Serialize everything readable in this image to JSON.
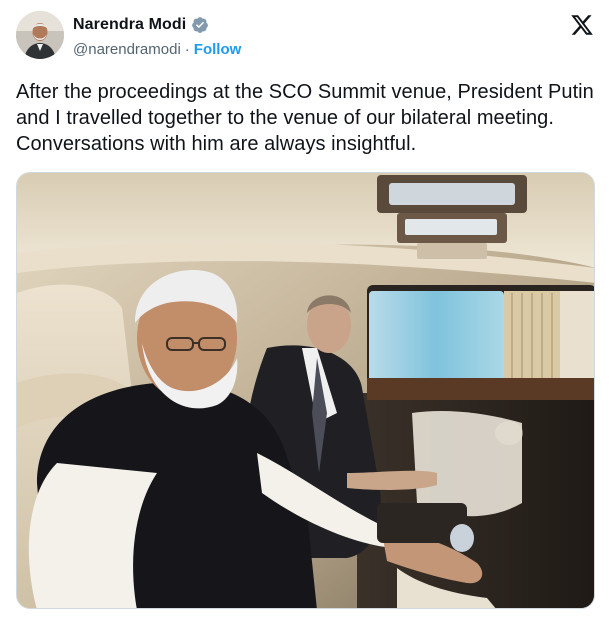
{
  "author": {
    "display_name": "Narendra Modi",
    "handle": "@narendramodi",
    "separator": "·",
    "follow_label": "Follow",
    "verified": true,
    "verified_color": "#829aab"
  },
  "platform": {
    "logo": "x-logo-icon"
  },
  "tweet": {
    "text": "After the proceedings at the SCO Summit venue, President Putin and I travelled together to the venue of our bilateral meeting. Conversations with him are always insightful."
  },
  "colors": {
    "link": "#1d9bf0",
    "secondary_text": "#536471",
    "primary_text": "#0f1419"
  },
  "media": {
    "type": "photo",
    "subject": "two-men-seated-in-car-interior"
  }
}
